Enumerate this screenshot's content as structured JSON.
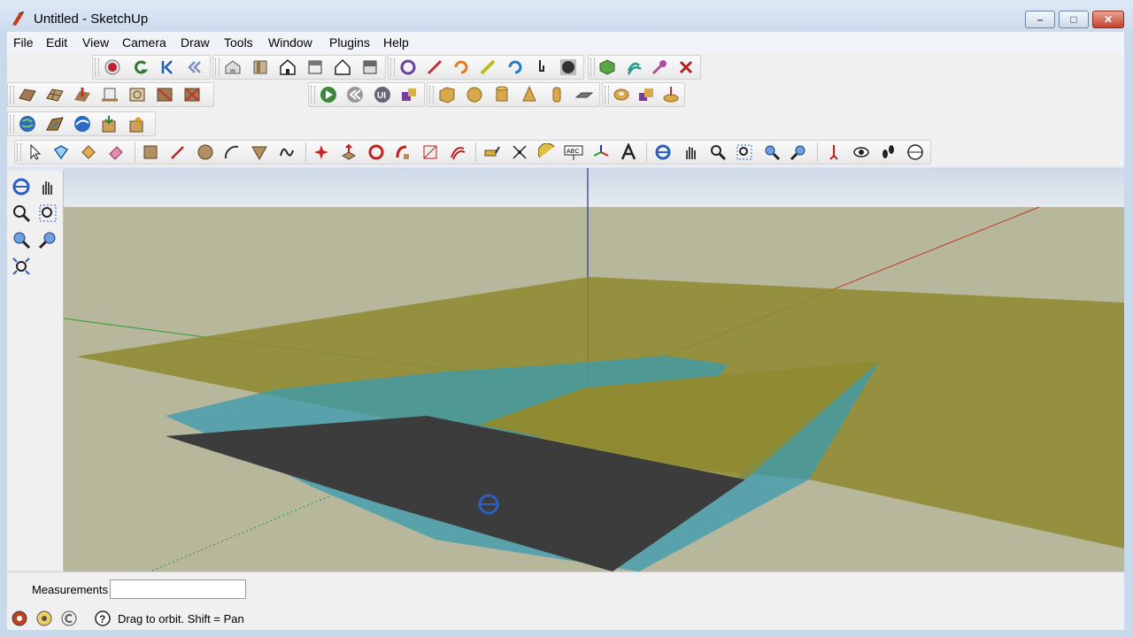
{
  "window": {
    "title": "Untitled - SketchUp",
    "minimize": "–",
    "maximize": "□",
    "close": "✕"
  },
  "menu": [
    "File",
    "Edit",
    "View",
    "Camera",
    "Draw",
    "Tools",
    "Window",
    "Plugins",
    "Help"
  ],
  "toolbar_row1": {
    "group1": [
      "record-icon",
      "undo-arrow-icon",
      "step-back-icon",
      "rewind-icon"
    ],
    "group2": [
      "iso-view-icon",
      "top-view-icon",
      "front-view-icon",
      "right-view-icon",
      "back-view-icon",
      "left-view-icon"
    ],
    "group3": [
      "orbit-icon",
      "line-icon",
      "rotate-icon",
      "pencil-icon",
      "refresh-icon",
      "paint-hand-icon",
      "black-circle-icon"
    ],
    "group4": [
      "green-cube-icon",
      "offset-icon",
      "tape-icon",
      "erase-x-icon"
    ]
  },
  "toolbar_row2": {
    "group1": [
      "sandbox-from-contours-icon",
      "sandbox-from-scratch-icon",
      "smoove-icon",
      "stamp-icon",
      "drape-icon",
      "flip-edge-icon"
    ],
    "group2": [
      "play-icon",
      "rewind-circle-icon",
      "ui-icon",
      "components-icon"
    ],
    "group3": [
      "box-icon",
      "sphere-icon",
      "cylinder-icon",
      "cone-icon",
      "tube-icon",
      "plane-icon"
    ],
    "group4": [
      "torus-icon",
      "solid-tools-icon",
      "push-icon"
    ]
  },
  "toolbar_row3": [
    "add-location-icon",
    "toggle-terrain-icon",
    "get-models-icon",
    "share-model-icon",
    "download-component-icon"
  ],
  "toolbar_row4": {
    "group1": [
      "select-icon",
      "make-component-icon",
      "paint-bucket-icon",
      "eraser-icon"
    ],
    "group2": [
      "rectangle-icon",
      "line-tool-icon",
      "circle-icon",
      "arc-icon",
      "polygon-icon",
      "freehand-icon"
    ],
    "group3": [
      "move-icon",
      "push-pull-icon",
      "rotate-tool-icon",
      "follow-me-icon",
      "scale-icon",
      "offset-tool-icon"
    ],
    "group4": [
      "tape-measure-icon",
      "dimension-icon",
      "protractor-icon",
      "text-icon",
      "axes-icon",
      "3d-text-icon"
    ],
    "group5": [
      "orbit-tool-icon",
      "pan-icon",
      "zoom-icon",
      "zoom-window-icon",
      "previous-view-icon",
      "next-view-icon"
    ],
    "group6": [
      "position-camera-icon",
      "look-around-icon",
      "walk-icon",
      "section-plane-icon"
    ]
  },
  "left_toolbar": [
    "orbit-icon",
    "pan-icon",
    "zoom-icon",
    "zoom-window-icon",
    "previous-icon",
    "next-icon",
    "zoom-extents-icon"
  ],
  "measurements": {
    "label": "Measurements",
    "value": ""
  },
  "status": {
    "hint": "Drag to orbit.  Shift = Pan",
    "icons": [
      "geo-location-icon",
      "credits-icon",
      "copyright-icon",
      "help-icon"
    ]
  },
  "colors": {
    "sky": "#dce4ee",
    "ground": "#b7b79c",
    "terrain": "#8f8a2f",
    "water": "#3a9bb0",
    "image": "#3c3c3c",
    "red_axis": "#c23a2a",
    "green_axis": "#2f9b2f",
    "blue_axis": "#27348f"
  }
}
